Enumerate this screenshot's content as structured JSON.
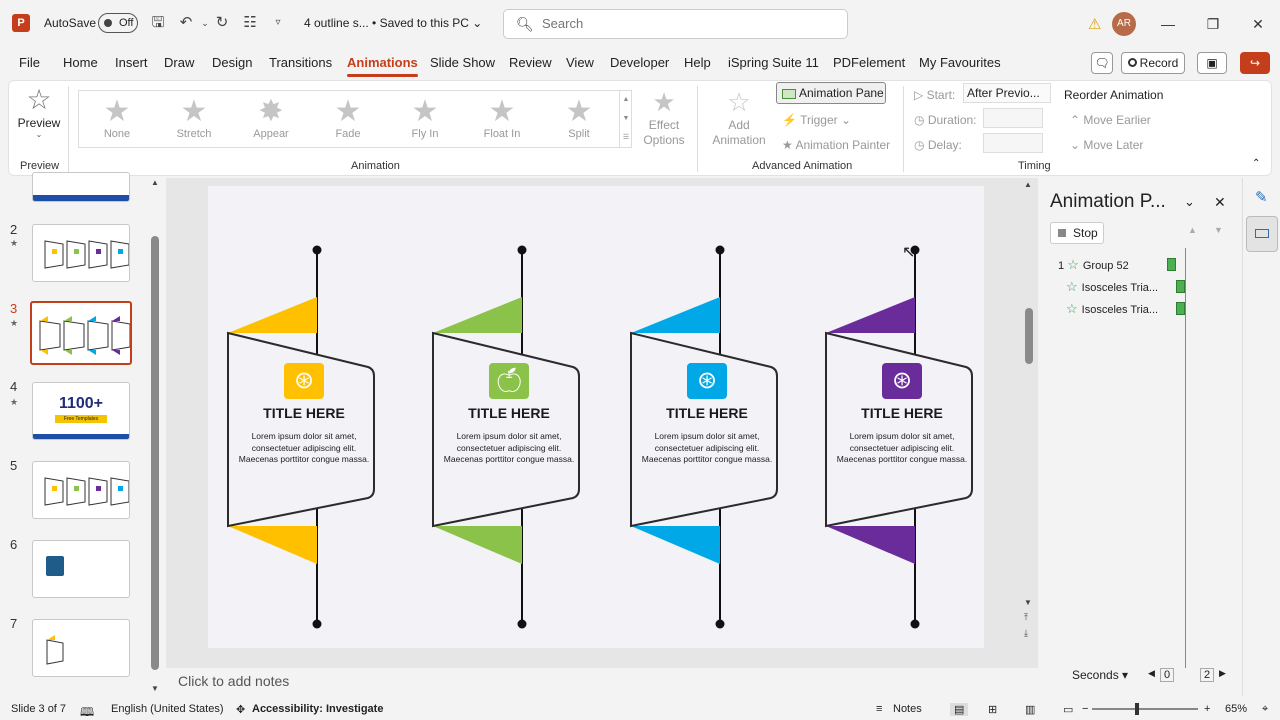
{
  "window": {
    "autosave_label": "AutoSave",
    "autosave_state": "Off",
    "doc_title": "4 outline s...  •  Saved to this PC ⌄",
    "search_placeholder": "Search",
    "avatar_initials": "AR"
  },
  "menu": {
    "tabs": [
      "File",
      "Home",
      "Insert",
      "Draw",
      "Design",
      "Transitions",
      "Animations",
      "Slide Show",
      "Review",
      "View",
      "Developer",
      "Help",
      "iSpring Suite 11",
      "PDFelement",
      "My Favourites"
    ],
    "active_tab": "Animations",
    "record_label": "Record"
  },
  "ribbon": {
    "preview_label": "Preview",
    "preview_group": "Preview",
    "animations": [
      "None",
      "Stretch",
      "Appear",
      "Fade",
      "Fly In",
      "Float In",
      "Split"
    ],
    "effect_options": "Effect Options",
    "animation_group": "Animation",
    "add_animation": "Add Animation",
    "animation_pane": "Animation Pane",
    "trigger": "Trigger",
    "animation_painter": "Animation Painter",
    "advanced_group": "Advanced Animation",
    "start_label": "Start:",
    "start_value": "After Previo...",
    "duration_label": "Duration:",
    "delay_label": "Delay:",
    "timing_group": "Timing",
    "reorder": "Reorder Animation",
    "move_earlier": "Move Earlier",
    "move_later": "Move Later"
  },
  "thumbnails": [
    {
      "num": "2",
      "star": true
    },
    {
      "num": "3",
      "star": true,
      "selected": true
    },
    {
      "num": "4",
      "star": true,
      "text": "1100+",
      "subtext": "Free Templates"
    },
    {
      "num": "5",
      "star": false
    },
    {
      "num": "6",
      "star": false
    },
    {
      "num": "7",
      "star": false
    }
  ],
  "slide": {
    "cards": [
      {
        "title": "TITLE HERE",
        "body": "Lorem ipsum dolor sit amet, consectetuer adipiscing elit. Maecenas porttitor congue massa.",
        "color": "#FFC000",
        "icon": "aperture-icon"
      },
      {
        "title": "TITLE HERE",
        "body": "Lorem ipsum dolor sit amet, consectetuer adipiscing elit. Maecenas porttitor congue massa.",
        "color": "#8BC34A",
        "icon": "apple-icon"
      },
      {
        "title": "TITLE HERE",
        "body": "Lorem ipsum dolor sit amet, consectetuer adipiscing elit. Maecenas porttitor congue massa.",
        "color": "#00A8E8",
        "icon": "aperture-icon"
      },
      {
        "title": "TITLE HERE",
        "body": "Lorem ipsum dolor sit amet, consectetuer adipiscing elit. Maecenas porttitor congue massa.",
        "color": "#6A2C9A",
        "icon": "aperture-icon"
      }
    ],
    "notes_placeholder": "Click to add notes"
  },
  "animation_pane": {
    "title": "Animation P...",
    "stop_label": "Stop",
    "items": [
      {
        "index": "1",
        "name": "Group 52"
      },
      {
        "index": "",
        "name": "Isosceles Tria..."
      },
      {
        "index": "",
        "name": "Isosceles Tria..."
      }
    ],
    "seconds_label": "Seconds ▾",
    "timeline_start": "0",
    "timeline_end": "2"
  },
  "status": {
    "slide_info": "Slide 3 of 7",
    "language": "English (United States)",
    "accessibility": "Accessibility: Investigate",
    "notes": "Notes",
    "zoom": "65%"
  },
  "colors": {
    "accent": "#C43E1C",
    "card_yellow": "#FFC000",
    "card_green": "#8BC34A",
    "card_blue": "#00A8E8",
    "card_purple": "#6A2C9A"
  }
}
